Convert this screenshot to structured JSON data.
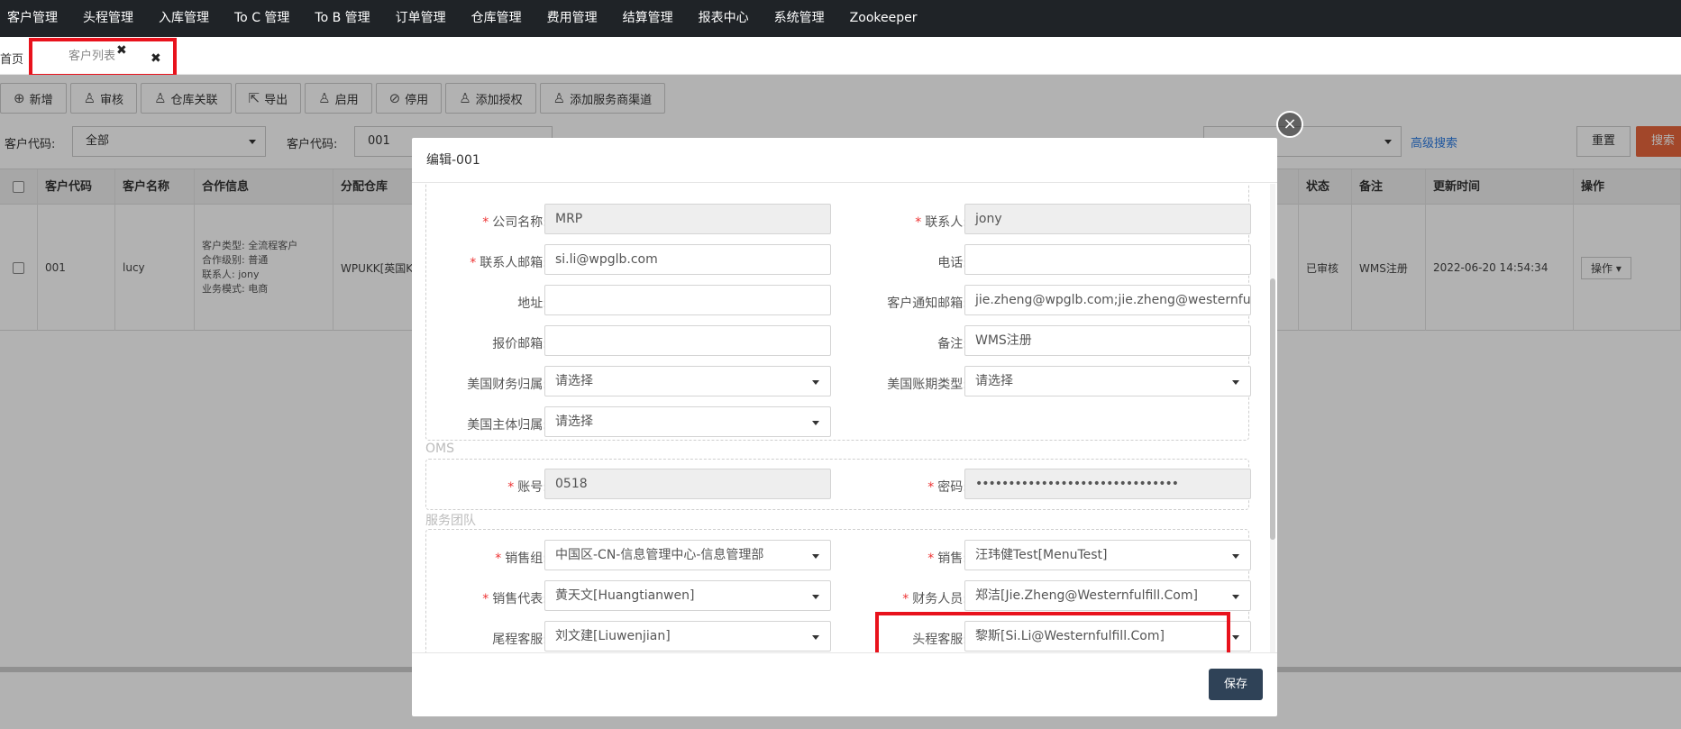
{
  "topnav": [
    "客户管理",
    "头程管理",
    "入库管理",
    "To C 管理",
    "To B 管理",
    "订单管理",
    "仓库管理",
    "费用管理",
    "结算管理",
    "报表中心",
    "系统管理",
    "Zookeeper"
  ],
  "tabs": {
    "home": "首页",
    "active": "客户列表",
    "close_small": "✖",
    "close_big": "✖"
  },
  "toolbar": [
    {
      "icon": "⊕",
      "label": "新增"
    },
    {
      "icon": "♙",
      "label": "审核"
    },
    {
      "icon": "♙",
      "label": "仓库关联"
    },
    {
      "icon": "⇱",
      "label": "导出"
    },
    {
      "icon": "♙",
      "label": "启用"
    },
    {
      "icon": "⊘",
      "label": "停用"
    },
    {
      "icon": "♙",
      "label": "添加授权"
    },
    {
      "icon": "♙",
      "label": "添加服务商渠道"
    }
  ],
  "filters": {
    "label1": "客户代码:",
    "select1": "全部",
    "label2": "客户代码:",
    "input2": "001",
    "advanced": "高级搜索",
    "reset": "重置",
    "search": "搜索"
  },
  "table": {
    "headers": {
      "code": "客户代码",
      "name": "客户名称",
      "coop": "合作信息",
      "warehouse": "分配仓库",
      "status": "状态",
      "remark": "备注",
      "updated": "更新时间",
      "ops": "操作"
    },
    "row": {
      "code": "001",
      "name": "lucy",
      "coop": [
        "客户类型: 全流程客户",
        "合作级别: 普通",
        "联系人: jony",
        "业务模式: 电商"
      ],
      "warehouse": "WPUKK[英国K",
      "status": "已审核",
      "remark": "WMS注册",
      "updated": "2022-06-20 14:54:34",
      "ops": "操作 ▾"
    }
  },
  "modal": {
    "title": "编辑-001",
    "close": "×",
    "fields": {
      "company_name": {
        "label": "公司名称:",
        "value": "MRP"
      },
      "contact": {
        "label": "联系人:",
        "value": "jony"
      },
      "contact_email": {
        "label": "联系人邮箱:",
        "value": "si.li@wpglb.com"
      },
      "phone": {
        "label": "电话:",
        "value": ""
      },
      "address": {
        "label": "地址:",
        "value": ""
      },
      "notify_email": {
        "label": "客户通知邮箱:",
        "value": "jie.zheng@wpglb.com;jie.zheng@westernful"
      },
      "quote_email": {
        "label": "报价邮箱:",
        "value": ""
      },
      "remark": {
        "label": "备注:",
        "value": "WMS注册"
      },
      "us_finance": {
        "label": "美国财务归属:",
        "value": "请选择"
      },
      "us_period": {
        "label": "美国账期类型:",
        "value": "请选择"
      },
      "us_entity": {
        "label": "美国主体归属:",
        "value": "请选择"
      }
    },
    "oms": {
      "legend": "OMS",
      "account": {
        "label": "账号:",
        "value": "0518"
      },
      "password": {
        "label": "密码:",
        "value": "•••••••••••••••••••••••••••••••"
      }
    },
    "team": {
      "legend": "服务团队",
      "sales_group": {
        "label": "销售组:",
        "value": "中国区-CN-信息管理中心-信息管理部"
      },
      "sales": {
        "label": "销售:",
        "value": "汪玮健Test[MenuTest]"
      },
      "sales_rep": {
        "label": "销售代表:",
        "value": "黄天文[Huangtianwen]"
      },
      "finance": {
        "label": "财务人员:",
        "value": "郑洁[Jie.Zheng@Westernfulfill.Com]"
      },
      "tail_cs": {
        "label": "尾程客服:",
        "value": "刘文建[Liuwenjian]"
      },
      "head_cs": {
        "label": "头程客服:",
        "value": "黎斯[Si.Li@Westernfulfill.Com]"
      }
    },
    "save": "保存"
  },
  "colors": {
    "highlight": "#e8121c",
    "save_button": "#2f4257",
    "search_button": "#e8663d",
    "nav_bg": "#1f2327"
  }
}
